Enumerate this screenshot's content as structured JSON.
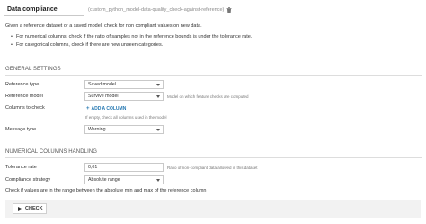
{
  "header": {
    "title": "Data compliance",
    "recipe_id": "(custom_python_model-data-quality_check-against-reference)",
    "trash_icon": "trash-icon"
  },
  "description": {
    "intro": "Given a reference dataset or a saved model, check for non compliant values on new data.",
    "bullets": [
      "For numerical columns, check if the ratio of samples not in the reference bounds is under the tolerance rate.",
      "For categorical columns, check if there are new unseen categories."
    ]
  },
  "general_settings": {
    "heading": "GENERAL SETTINGS",
    "reference_type": {
      "label": "Reference type",
      "value": "Saved model"
    },
    "reference_model": {
      "label": "Reference model",
      "value": "Survive model",
      "hint": "Model on which feature checks are computed"
    },
    "columns_to_check": {
      "label": "Columns to check",
      "add_label": "ADD A COLUMN",
      "hint": "If empty, check all columns used in the model"
    },
    "message_type": {
      "label": "Message type",
      "value": "Warning"
    }
  },
  "numerical_settings": {
    "heading": "NUMERICAL COLUMNS HANDLING",
    "tolerance_rate": {
      "label": "Tolerance rate",
      "value": "0,01",
      "hint": "Ratio of non-compliant data allowed in this dataset"
    },
    "compliance_strategy": {
      "label": "Compliance strategy",
      "value": "Absolute range"
    },
    "strategy_note": "Check if values are in the range between the absolute min and max of the reference column"
  },
  "footer": {
    "check_label": "CHECK"
  },
  "colors": {
    "link": "#2678b2",
    "border": "#c9c9c9",
    "footer_bg": "#f2f2f2"
  }
}
